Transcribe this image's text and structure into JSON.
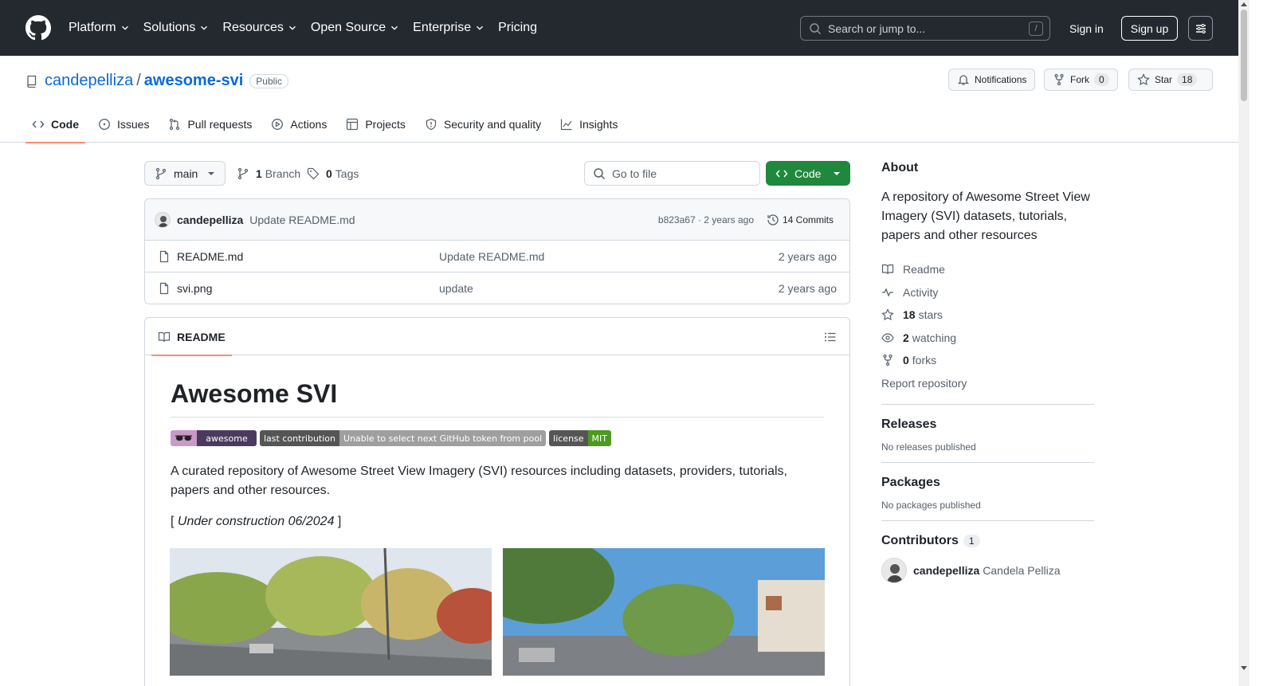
{
  "nav": {
    "items": [
      "Platform",
      "Solutions",
      "Resources",
      "Open Source",
      "Enterprise"
    ],
    "pricing": "Pricing",
    "search_placeholder": "Search or jump to...",
    "search_shortcut": "/",
    "sign_in": "Sign in",
    "sign_up": "Sign up"
  },
  "repo": {
    "owner": "candepelliza",
    "separator": "/",
    "name": "awesome-svi",
    "visibility": "Public",
    "notifications_label": "Notifications",
    "fork_label": "Fork",
    "fork_count": "0",
    "star_label": "Star",
    "star_count": "18"
  },
  "tabs": {
    "code": "Code",
    "issues": "Issues",
    "pulls": "Pull requests",
    "actions": "Actions",
    "projects": "Projects",
    "security": "Security and quality",
    "insights": "Insights"
  },
  "toolbar": {
    "branch": "main",
    "branch_count": "1",
    "branch_label": "Branch",
    "tag_count": "0",
    "tag_label": "Tags",
    "go_to_file": "Go to file",
    "code_button": "Code"
  },
  "commit": {
    "author": "candepelliza",
    "message": "Update README.md",
    "hash_time": "b823a67 · 2 years ago",
    "commits": "14 Commits"
  },
  "files": [
    {
      "name": "README.md",
      "message": "Update README.md",
      "date": "2 years ago"
    },
    {
      "name": "svi.png",
      "message": "update",
      "date": "2 years ago"
    }
  ],
  "readme": {
    "tab_label": "README",
    "title": "Awesome SVI",
    "badges": {
      "awesome": "awesome",
      "contrib_left": "last contribution",
      "contrib_right": "Unable to select next GitHub token from pool",
      "license_left": "license",
      "license_right": "MIT"
    },
    "paragraph": "A curated repository of Awesome Street View Imagery (SVI) resources including datasets, providers, tutorials, papers and other resources.",
    "construction_open": "[ ",
    "construction_text": "Under construction 06/2024",
    "construction_close": " ]"
  },
  "sidebar": {
    "about_title": "About",
    "description": "A repository of Awesome Street View Imagery (SVI) datasets, tutorials, papers and other resources",
    "readme": "Readme",
    "activity": "Activity",
    "stars_count": "18",
    "stars_label": "stars",
    "watching_count": "2",
    "watching_label": "watching",
    "forks_count": "0",
    "forks_label": "forks",
    "report": "Report repository",
    "releases_title": "Releases",
    "releases_none": "No releases published",
    "packages_title": "Packages",
    "packages_none": "No packages published",
    "contributors_title": "Contributors",
    "contributors_count": "1",
    "contributor_login": "candepelliza",
    "contributor_name": "Candela Pelliza"
  },
  "colors": {
    "header_bg": "#24292f",
    "link": "#0969da",
    "code_button": "#1f883d",
    "tab_underline": "#fd8c73"
  }
}
